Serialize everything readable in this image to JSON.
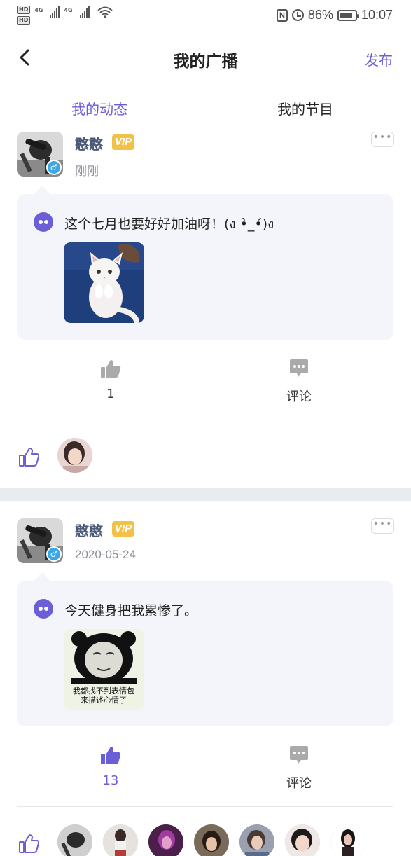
{
  "status_bar": {
    "hd1": "HD",
    "hd2": "HD",
    "net1": "4G",
    "net2": "4G",
    "battery_percent": "86%",
    "battery_level": 0.86,
    "time": "10:07",
    "nfc": "N"
  },
  "header": {
    "title": "我的广播",
    "publish": "发布"
  },
  "tabs": [
    {
      "label": "我的动态",
      "active": true
    },
    {
      "label": "我的节目",
      "active": false
    }
  ],
  "posts": [
    {
      "username": "憨憨",
      "vip": "VIP",
      "gender": "♂",
      "time": "刚刚",
      "text": "这个七月也要好好加油呀！(ง •̀_•́)ง",
      "image": "white-kitten-photo",
      "like_count": "1",
      "comment_label": "评论",
      "liked": false,
      "likers": [
        "liker-avatar-1"
      ]
    },
    {
      "username": "憨憨",
      "vip": "VIP",
      "gender": "♂",
      "time": "2020-05-24",
      "text": "今天健身把我累惨了。",
      "image": "panda-meme",
      "meme_caption_line1": "我都找不到表情包",
      "meme_caption_line2": "来描述心情了",
      "like_count": "13",
      "comment_label": "评论",
      "liked": true,
      "likers": [
        "liker-avatar-1",
        "liker-avatar-2",
        "liker-avatar-3",
        "liker-avatar-4",
        "liker-avatar-5",
        "liker-avatar-6",
        "liker-avatar-7"
      ]
    }
  ],
  "more_glyph": "•••",
  "colors": {
    "accent": "#6b5fd8",
    "vip": "#f2c14a",
    "gender_badge": "#3aa8e8",
    "username": "#4a5a78",
    "bubble_bg": "#f4f5fa",
    "divider_gap": "#e9ecef"
  },
  "icons": {
    "back": "chevron-left-icon",
    "post_type": "dots-bubble-icon",
    "like": "thumbs-up-icon",
    "comment": "comment-bubble-icon",
    "more": "more-dots-icon"
  }
}
